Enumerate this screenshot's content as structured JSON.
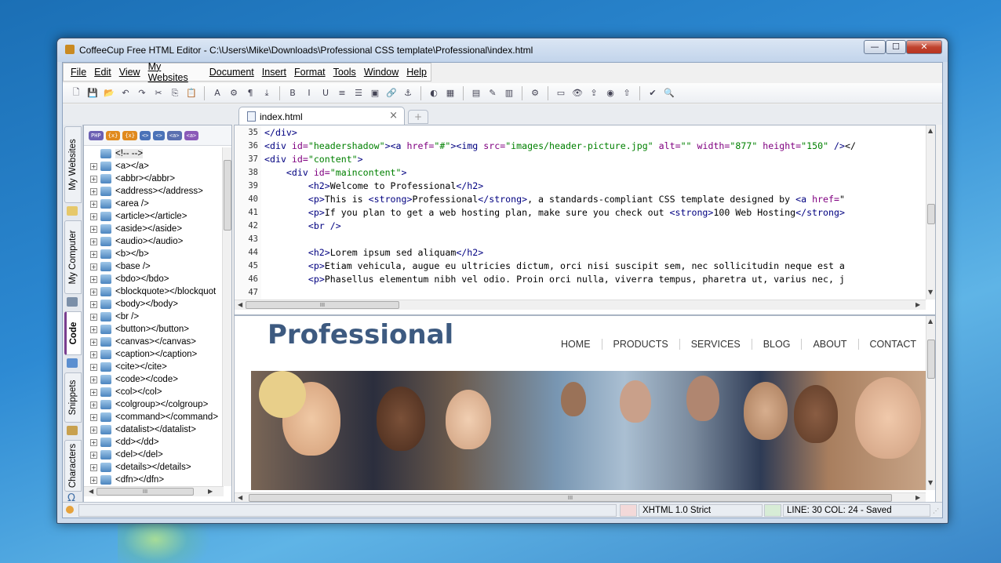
{
  "window": {
    "title": "CoffeeCup Free HTML Editor - C:\\Users\\Mike\\Downloads\\Professional CSS template\\Professional\\index.html"
  },
  "caption_buttons": {
    "minimize": "—",
    "maximize": "☐",
    "close": "✕"
  },
  "menu": [
    "File",
    "Edit",
    "View",
    "My Websites",
    "Document",
    "Insert",
    "Format",
    "Tools",
    "Window",
    "Help"
  ],
  "toolbar_icons": [
    "new-file",
    "save",
    "open",
    "undo",
    "redo",
    "cut",
    "copy",
    "paste",
    "font",
    "tag",
    "paragraph",
    "download",
    "bold",
    "italic",
    "underline",
    "align",
    "list",
    "image",
    "link",
    "anchor",
    "color-picker",
    "table",
    "form",
    "edit",
    "columns",
    "settings",
    "layout",
    "preview",
    "upload",
    "globe",
    "publish",
    "spellcheck",
    "search"
  ],
  "tabs": {
    "active": "index.html",
    "close": "×",
    "new_tab": "+"
  },
  "vertical_tabs": [
    "My Websites",
    "My Computer",
    "Code",
    "Snippets",
    "Characters"
  ],
  "tag_toolbar": [
    "PHP",
    "{x}",
    "{x}",
    "<>",
    "<>",
    "<a>",
    "<a>"
  ],
  "tags": [
    "<!-- -->",
    "<a></a>",
    "<abbr></abbr>",
    "<address></address>",
    "<area />",
    "<article></article>",
    "<aside></aside>",
    "<audio></audio>",
    "<b></b>",
    "<base />",
    "<bdo></bdo>",
    "<blockquote></blockquot",
    "<body></body>",
    "<br />",
    "<button></button>",
    "<canvas></canvas>",
    "<caption></caption>",
    "<cite></cite>",
    "<code></code>",
    "<col></col>",
    "<colgroup></colgroup>",
    "<command></command>",
    "<datalist></datalist>",
    "<dd></dd>",
    "<del></del>",
    "<details></details>",
    "<dfn></dfn>"
  ],
  "code": {
    "line_numbers": [
      "35",
      "36",
      "37",
      "38",
      "39",
      "40",
      "41",
      "42",
      "43",
      "44",
      "45",
      "46",
      "47"
    ],
    "lines": [
      "</div>",
      "<div id=\"headershadow\"><a href=\"#\"><img src=\"images/header-picture.jpg\" alt=\"\" width=\"877\" height=\"150\" /></",
      "<div id=\"content\">",
      "    <div id=\"maincontent\">",
      "        <h2>Welcome to Professional</h2>",
      "        <p>This is <strong>Professional</strong>, a standards-compliant CSS template designed by <a href=\"",
      "        <p>If you plan to get a web hosting plan, make sure you check out <strong>100 Web Hosting</strong>",
      "        <br />",
      "",
      "        <h2>Lorem ipsum sed aliquam</h2>",
      "        <p>Etiam vehicula, augue eu ultricies dictum, orci nisi suscipit sem, nec sollicitudin neque est a",
      "        <p>Phasellus elementum nibh vel odio. Proin orci nulla, viverra tempus, pharetra ut, varius nec, j",
      ""
    ]
  },
  "preview": {
    "brand": "Professional",
    "nav": [
      "HOME",
      "PRODUCTS",
      "SERVICES",
      "BLOG",
      "ABOUT",
      "CONTACT"
    ]
  },
  "status": {
    "doctype": "XHTML 1.0 Strict",
    "position": "LINE: 30  COL: 24 - Saved"
  },
  "scroll_grip": "III",
  "colors": {
    "accent": "#7a3e8f",
    "brand_text": "#3d5a80",
    "code_tag": "#000080",
    "code_value": "#008000"
  }
}
